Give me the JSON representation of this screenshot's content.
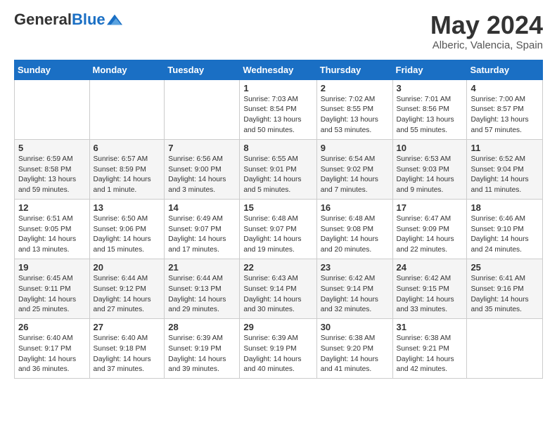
{
  "header": {
    "logo_general": "General",
    "logo_blue": "Blue",
    "title": "May 2024",
    "location": "Alberic, Valencia, Spain"
  },
  "weekdays": [
    "Sunday",
    "Monday",
    "Tuesday",
    "Wednesday",
    "Thursday",
    "Friday",
    "Saturday"
  ],
  "weeks": [
    [
      {
        "day": "",
        "info": ""
      },
      {
        "day": "",
        "info": ""
      },
      {
        "day": "",
        "info": ""
      },
      {
        "day": "1",
        "info": "Sunrise: 7:03 AM\nSunset: 8:54 PM\nDaylight: 13 hours\nand 50 minutes."
      },
      {
        "day": "2",
        "info": "Sunrise: 7:02 AM\nSunset: 8:55 PM\nDaylight: 13 hours\nand 53 minutes."
      },
      {
        "day": "3",
        "info": "Sunrise: 7:01 AM\nSunset: 8:56 PM\nDaylight: 13 hours\nand 55 minutes."
      },
      {
        "day": "4",
        "info": "Sunrise: 7:00 AM\nSunset: 8:57 PM\nDaylight: 13 hours\nand 57 minutes."
      }
    ],
    [
      {
        "day": "5",
        "info": "Sunrise: 6:59 AM\nSunset: 8:58 PM\nDaylight: 13 hours\nand 59 minutes."
      },
      {
        "day": "6",
        "info": "Sunrise: 6:57 AM\nSunset: 8:59 PM\nDaylight: 14 hours\nand 1 minute."
      },
      {
        "day": "7",
        "info": "Sunrise: 6:56 AM\nSunset: 9:00 PM\nDaylight: 14 hours\nand 3 minutes."
      },
      {
        "day": "8",
        "info": "Sunrise: 6:55 AM\nSunset: 9:01 PM\nDaylight: 14 hours\nand 5 minutes."
      },
      {
        "day": "9",
        "info": "Sunrise: 6:54 AM\nSunset: 9:02 PM\nDaylight: 14 hours\nand 7 minutes."
      },
      {
        "day": "10",
        "info": "Sunrise: 6:53 AM\nSunset: 9:03 PM\nDaylight: 14 hours\nand 9 minutes."
      },
      {
        "day": "11",
        "info": "Sunrise: 6:52 AM\nSunset: 9:04 PM\nDaylight: 14 hours\nand 11 minutes."
      }
    ],
    [
      {
        "day": "12",
        "info": "Sunrise: 6:51 AM\nSunset: 9:05 PM\nDaylight: 14 hours\nand 13 minutes."
      },
      {
        "day": "13",
        "info": "Sunrise: 6:50 AM\nSunset: 9:06 PM\nDaylight: 14 hours\nand 15 minutes."
      },
      {
        "day": "14",
        "info": "Sunrise: 6:49 AM\nSunset: 9:07 PM\nDaylight: 14 hours\nand 17 minutes."
      },
      {
        "day": "15",
        "info": "Sunrise: 6:48 AM\nSunset: 9:07 PM\nDaylight: 14 hours\nand 19 minutes."
      },
      {
        "day": "16",
        "info": "Sunrise: 6:48 AM\nSunset: 9:08 PM\nDaylight: 14 hours\nand 20 minutes."
      },
      {
        "day": "17",
        "info": "Sunrise: 6:47 AM\nSunset: 9:09 PM\nDaylight: 14 hours\nand 22 minutes."
      },
      {
        "day": "18",
        "info": "Sunrise: 6:46 AM\nSunset: 9:10 PM\nDaylight: 14 hours\nand 24 minutes."
      }
    ],
    [
      {
        "day": "19",
        "info": "Sunrise: 6:45 AM\nSunset: 9:11 PM\nDaylight: 14 hours\nand 25 minutes."
      },
      {
        "day": "20",
        "info": "Sunrise: 6:44 AM\nSunset: 9:12 PM\nDaylight: 14 hours\nand 27 minutes."
      },
      {
        "day": "21",
        "info": "Sunrise: 6:44 AM\nSunset: 9:13 PM\nDaylight: 14 hours\nand 29 minutes."
      },
      {
        "day": "22",
        "info": "Sunrise: 6:43 AM\nSunset: 9:14 PM\nDaylight: 14 hours\nand 30 minutes."
      },
      {
        "day": "23",
        "info": "Sunrise: 6:42 AM\nSunset: 9:14 PM\nDaylight: 14 hours\nand 32 minutes."
      },
      {
        "day": "24",
        "info": "Sunrise: 6:42 AM\nSunset: 9:15 PM\nDaylight: 14 hours\nand 33 minutes."
      },
      {
        "day": "25",
        "info": "Sunrise: 6:41 AM\nSunset: 9:16 PM\nDaylight: 14 hours\nand 35 minutes."
      }
    ],
    [
      {
        "day": "26",
        "info": "Sunrise: 6:40 AM\nSunset: 9:17 PM\nDaylight: 14 hours\nand 36 minutes."
      },
      {
        "day": "27",
        "info": "Sunrise: 6:40 AM\nSunset: 9:18 PM\nDaylight: 14 hours\nand 37 minutes."
      },
      {
        "day": "28",
        "info": "Sunrise: 6:39 AM\nSunset: 9:19 PM\nDaylight: 14 hours\nand 39 minutes."
      },
      {
        "day": "29",
        "info": "Sunrise: 6:39 AM\nSunset: 9:19 PM\nDaylight: 14 hours\nand 40 minutes."
      },
      {
        "day": "30",
        "info": "Sunrise: 6:38 AM\nSunset: 9:20 PM\nDaylight: 14 hours\nand 41 minutes."
      },
      {
        "day": "31",
        "info": "Sunrise: 6:38 AM\nSunset: 9:21 PM\nDaylight: 14 hours\nand 42 minutes."
      },
      {
        "day": "",
        "info": ""
      }
    ]
  ]
}
